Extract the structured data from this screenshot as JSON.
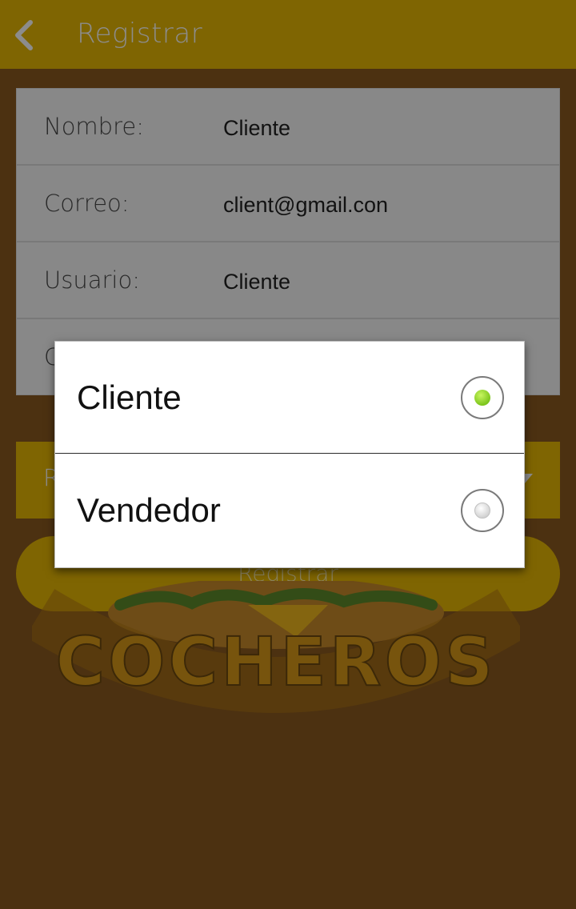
{
  "appbar": {
    "title": "Registrar",
    "back_icon": "chevron-left-icon"
  },
  "form": {
    "rows": [
      {
        "label": "Nombre:",
        "value": "Cliente"
      },
      {
        "label": "Correo:",
        "value": "client@gmail.con"
      },
      {
        "label": "Usuario:",
        "value": "Cliente"
      },
      {
        "label": "C",
        "value": ""
      }
    ]
  },
  "role_select": {
    "label": "R",
    "dropdown_icon": "caret-down-icon"
  },
  "register_button": {
    "label": "Registrar"
  },
  "logo": {
    "text": "COCHEROS"
  },
  "dialog": {
    "options": [
      {
        "label": "Cliente",
        "selected": true
      },
      {
        "label": "Vendedor",
        "selected": false
      }
    ]
  },
  "colors": {
    "brand_yellow": "#e8b804",
    "background": "#8a5a1f",
    "radio_selected": "#7cc51c"
  }
}
